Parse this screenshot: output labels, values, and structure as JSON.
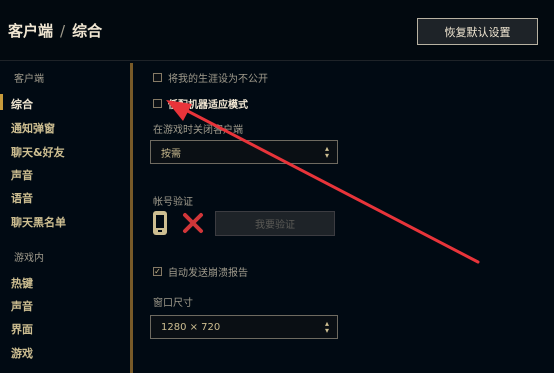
{
  "header": {
    "breadcrumb_root": "客户端",
    "breadcrumb_sep": "/",
    "breadcrumb_current": "综合",
    "restore_button": "恢复默认设置"
  },
  "sidebar": {
    "client_section": "客户端",
    "client_items": [
      "综合",
      "通知弹窗",
      "聊天&好友",
      "声音",
      "语音",
      "聊天黑名单"
    ],
    "ingame_section": "游戏内",
    "ingame_items": [
      "热键",
      "声音",
      "界面",
      "游戏"
    ]
  },
  "main": {
    "private_career": "将我的生涯设为不公开",
    "low_spec_mode": "低配机器适应模式",
    "close_client_label": "在游戏时关闭客户端",
    "close_client_value": "按需",
    "account_verify_label": "帐号验证",
    "verify_button": "我要验证",
    "auto_report": "自动发送崩溃报告",
    "window_size_label": "窗口尺寸",
    "window_size_value": "1280 × 720"
  },
  "colors": {
    "background": "#010a13",
    "gold": "#c89b3c",
    "arrow_red": "#e8343a"
  }
}
